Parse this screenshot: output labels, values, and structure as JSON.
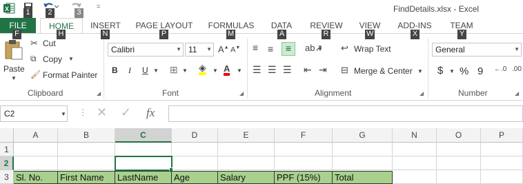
{
  "window": {
    "title": "FindDetails.xlsx - Excel",
    "qat_keytips": [
      "1",
      "2",
      "3"
    ]
  },
  "tabs": [
    {
      "label": "FILE",
      "keytip": "F"
    },
    {
      "label": "HOME",
      "keytip": "H"
    },
    {
      "label": "INSERT",
      "keytip": "N"
    },
    {
      "label": "PAGE LAYOUT",
      "keytip": "P"
    },
    {
      "label": "FORMULAS",
      "keytip": "M"
    },
    {
      "label": "DATA",
      "keytip": "A"
    },
    {
      "label": "REVIEW",
      "keytip": "R"
    },
    {
      "label": "VIEW",
      "keytip": "W"
    },
    {
      "label": "ADD-INS",
      "keytip": "X"
    },
    {
      "label": "TEAM",
      "keytip": "Y"
    }
  ],
  "clipboard": {
    "paste": "Paste",
    "cut": "Cut",
    "copy": "Copy",
    "format_painter": "Format Painter",
    "group": "Clipboard"
  },
  "font": {
    "name": "Calibri",
    "size": "11",
    "group": "Font",
    "bold": "B",
    "italic": "I",
    "underline": "U"
  },
  "alignment": {
    "wrap_text": "Wrap Text",
    "merge_center": "Merge & Center",
    "group": "Alignment"
  },
  "number": {
    "format": "General",
    "currency": "$",
    "percent": "%",
    "comma": "9",
    "group": "Number"
  },
  "formula_bar": {
    "name_box": "C2",
    "fx": "fx",
    "value": ""
  },
  "sheet": {
    "columns": [
      "A",
      "B",
      "C",
      "D",
      "E",
      "F",
      "G",
      "N",
      "O",
      "P"
    ],
    "rows": [
      "1",
      "2",
      "3"
    ],
    "header_row": [
      "Sl. No.",
      "First Name",
      "LastName",
      "Age",
      "Salary",
      "PPF (15%)",
      "Total"
    ],
    "header_fill": "#a9d18e",
    "selected_cell": "C2"
  },
  "colors": {
    "accent": "#217346"
  }
}
